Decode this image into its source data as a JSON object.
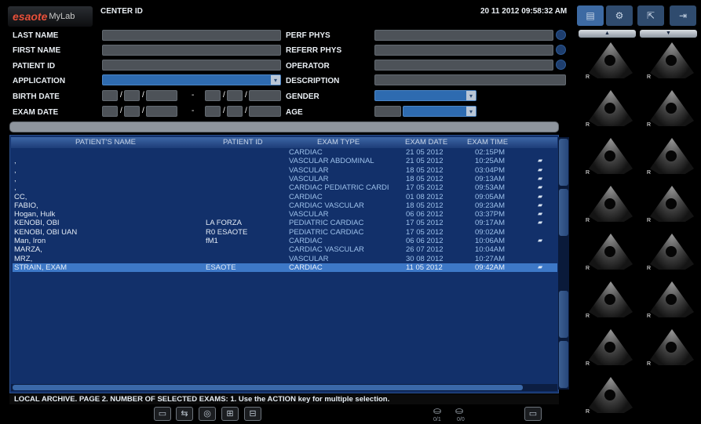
{
  "header": {
    "brand": "esaote",
    "brand_sub": "MyLab",
    "center_id_label": "CENTER ID",
    "datetime": "20 11 2012 09:58:32 AM"
  },
  "form": {
    "last_name": "LAST NAME",
    "first_name": "FIRST NAME",
    "patient_id": "PATIENT ID",
    "application": "APPLICATION",
    "birth_date": "BIRTH DATE",
    "exam_date": "EXAM DATE",
    "perf_phys": "PERF PHYS",
    "referr_phys": "REFERR PHYS",
    "operator": "OPERATOR",
    "description": "DESCRIPTION",
    "gender": "GENDER",
    "age": "AGE",
    "date_sep": "/",
    "range_sep": "-"
  },
  "table": {
    "headers": [
      "PATIENT'S NAME",
      "PATIENT ID",
      "EXAM TYPE",
      "EXAM DATE",
      "EXAM TIME"
    ],
    "rows": [
      {
        "name": "",
        "pid": "",
        "type": "CARDIAC",
        "date": "21 05 2012",
        "time": "02:15PM",
        "icon": ""
      },
      {
        "name": ",",
        "pid": "",
        "type": "VASCULAR ABDOMINAL",
        "date": "21 05 2012",
        "time": "10:25AM",
        "icon": "▰"
      },
      {
        "name": ",",
        "pid": "",
        "type": "VASCULAR",
        "date": "18 05 2012",
        "time": "03:04PM",
        "icon": "▰"
      },
      {
        "name": ",",
        "pid": "",
        "type": "VASCULAR",
        "date": "18 05 2012",
        "time": "09:13AM",
        "icon": "▰"
      },
      {
        "name": ",",
        "pid": "",
        "type": "CARDIAC PEDIATRIC CARDI",
        "date": "17 05 2012",
        "time": "09:53AM",
        "icon": "▰"
      },
      {
        "name": "CC,",
        "pid": "",
        "type": "CARDIAC",
        "date": "01 08 2012",
        "time": "09:05AM",
        "icon": "▰"
      },
      {
        "name": "FABIO,",
        "pid": "",
        "type": "CARDIAC VASCULAR",
        "date": "18 05 2012",
        "time": "09:23AM",
        "icon": "▰"
      },
      {
        "name": "Hogan, Hulk",
        "pid": "",
        "type": "VASCULAR",
        "date": "06 06 2012",
        "time": "03:37PM",
        "icon": "▰"
      },
      {
        "name": "KENOBI, OBI",
        "pid": "LA FORZA",
        "type": "PEDIATRIC CARDIAC",
        "date": "17 05 2012",
        "time": "09:17AM",
        "icon": "▰"
      },
      {
        "name": "KENOBI, OBI UAN",
        "pid": "R0 ESAOTE",
        "type": "PEDIATRIC CARDIAC",
        "date": "17 05 2012",
        "time": "09:02AM",
        "icon": ""
      },
      {
        "name": "Man, Iron",
        "pid": "fM1",
        "type": "CARDIAC",
        "date": "06 06 2012",
        "time": "10:06AM",
        "icon": "▰"
      },
      {
        "name": "MARZA,",
        "pid": "",
        "type": "CARDIAC VASCULAR",
        "date": "26 07 2012",
        "time": "10:04AM",
        "icon": ""
      },
      {
        "name": "MRZ,",
        "pid": "",
        "type": "VASCULAR",
        "date": "30 08 2012",
        "time": "10:27AM",
        "icon": ""
      },
      {
        "name": "STRAIN, EXAM",
        "pid": "ESAOTE",
        "type": "CARDIAC",
        "date": "11 05 2012",
        "time": "09:42AM",
        "icon": "▰",
        "selected": true
      }
    ]
  },
  "status": "LOCAL ARCHIVE.  PAGE 2.  NUMBER OF SELECTED EXAMS: 1.  Use the ACTION key for multiple selection.",
  "bottom": {
    "disk_labels": [
      "0/1",
      "0/0"
    ]
  },
  "thumbs": {
    "tags": [
      "R",
      "R",
      "R",
      "R",
      "R",
      "R",
      "R",
      "R",
      "R",
      "R",
      "R",
      "R",
      "R",
      "R",
      "R"
    ]
  },
  "colors": {
    "list_bg": "#12306a",
    "selected_row": "#3d78c7",
    "accent_red": "#e8503a"
  }
}
